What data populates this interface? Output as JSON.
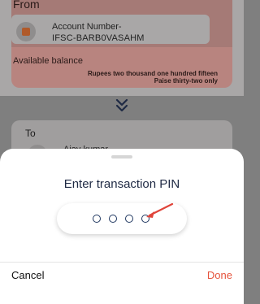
{
  "background": {
    "from_label": "From",
    "account_number_label": "Account Number-",
    "ifsc": "IFSC-BARB0VASAHM",
    "available_balance_label": "Available balance",
    "amount_in_words": "Rupees two thousand one hundred fifteen Paise thirty-two only",
    "to_label": "To",
    "to_name": "Ajay kumar"
  },
  "sheet": {
    "title": "Enter transaction PIN",
    "pin_length": 4,
    "cancel_label": "Cancel",
    "done_label": "Done"
  },
  "colors": {
    "accent": "#e5533c",
    "pin_dot": "#1f3760",
    "overlay": "#7f7f7f",
    "title": "#1f2a44"
  },
  "icons": {
    "bank": "bank-logo-icon",
    "swap": "double-chevron-down-icon",
    "arrow": "red-pointer-arrow-icon"
  }
}
